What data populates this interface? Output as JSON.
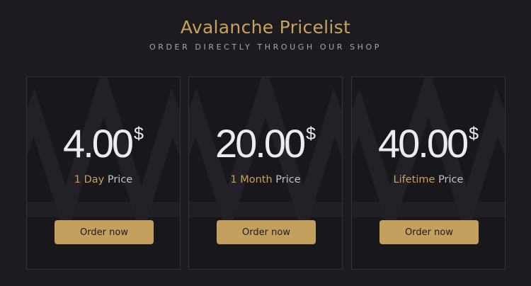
{
  "header": {
    "title": "Avalanche Pricelist",
    "subtitle": "ORDER DIRECTLY THROUGH OUR SHOP"
  },
  "plans": [
    {
      "amount": "4.00",
      "currency": "$",
      "period": "1 Day",
      "price_word": "Price",
      "button_label": "Order now"
    },
    {
      "amount": "20.00",
      "currency": "$",
      "period": "1 Month",
      "price_word": "Price",
      "button_label": "Order now"
    },
    {
      "amount": "40.00",
      "currency": "$",
      "period": "Lifetime",
      "price_word": "Price",
      "button_label": "Order now"
    }
  ],
  "colors": {
    "background": "#1c1b20",
    "accent": "#c9a25a",
    "button": "#c4a05f",
    "text": "#ececee"
  },
  "icons": {
    "card_background": "avalanche-logo-watermark-icon"
  }
}
